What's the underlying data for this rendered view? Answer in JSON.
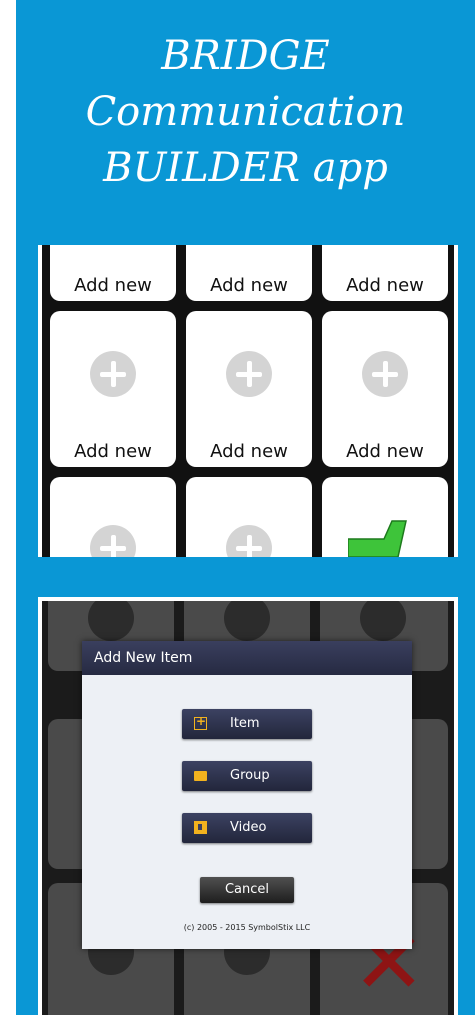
{
  "title": {
    "line1": "BRIDGE",
    "line2": "Communication",
    "line3": "BUILDER app"
  },
  "screen1": {
    "tile_label": "Add new",
    "tiles": [
      {
        "label": "Add new",
        "icon": "plus-circle-icon"
      },
      {
        "label": "Add new",
        "icon": "plus-circle-icon"
      },
      {
        "label": "Add new",
        "icon": "plus-circle-icon"
      },
      {
        "label": "Add new",
        "icon": "plus-circle-icon"
      },
      {
        "label": "Add new",
        "icon": "plus-circle-icon"
      },
      {
        "label": "Add new",
        "icon": "plus-circle-icon"
      },
      {
        "label": "",
        "icon": "plus-circle-icon"
      },
      {
        "label": "",
        "icon": "plus-circle-icon"
      },
      {
        "label": "",
        "icon": "green-arrow-icon"
      }
    ]
  },
  "dialog": {
    "title": "Add New Item",
    "options": [
      {
        "label": "Item",
        "icon": "add-item-icon"
      },
      {
        "label": "Group",
        "icon": "folder-icon"
      },
      {
        "label": "Video",
        "icon": "video-icon"
      }
    ],
    "cancel_label": "Cancel",
    "copyright": "(c) 2005 - 2015 SymbolStix LLC"
  },
  "colors": {
    "background": "#0a97d5",
    "dialog_header": "#2e3350",
    "accent_yellow": "#f2b21e",
    "green_arrow": "#3ec43a",
    "red_x": "#8e1414"
  }
}
